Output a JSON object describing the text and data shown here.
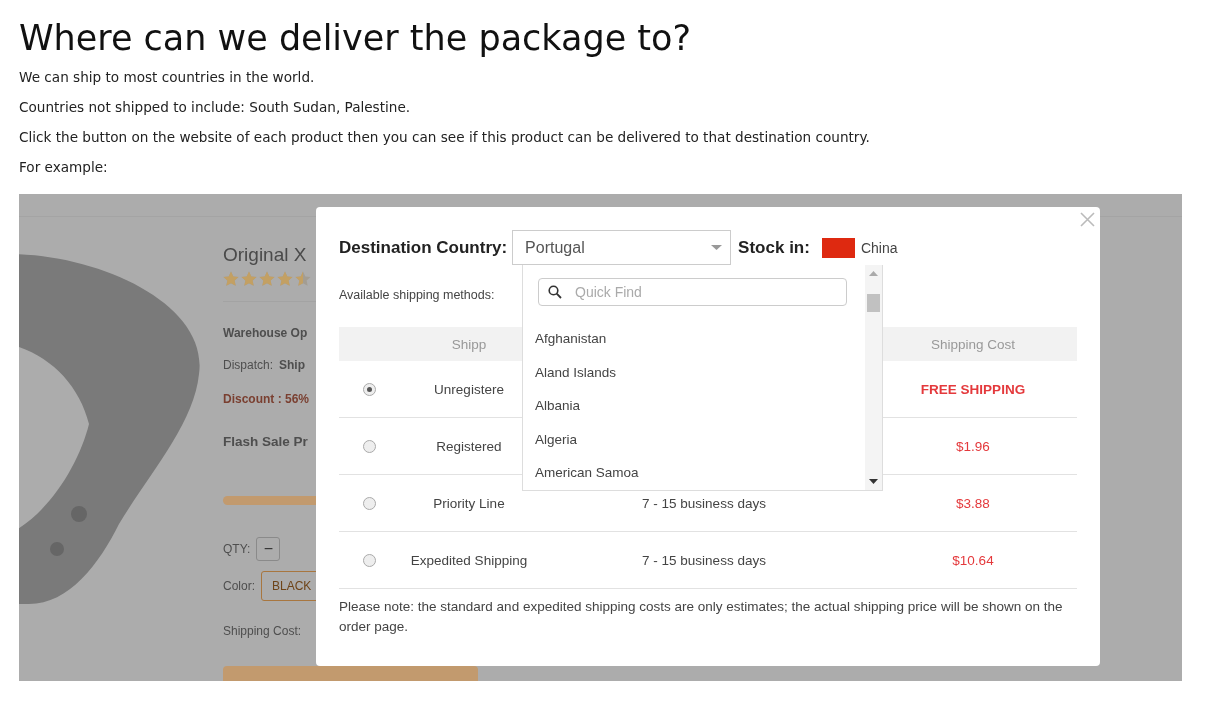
{
  "heading": "Where can we deliver the package to?",
  "paragraphs": [
    "We can ship to most countries in the world.",
    "Countries not shipped to include: South Sudan, Palestine.",
    "Click the button on the website of each product then you can see if this product can be delivered to that destination country.",
    "For example:"
  ],
  "product_page": {
    "title": "Original X",
    "stars": 4.5,
    "warehouse_label": "Warehouse Op",
    "dispatch_label": "Dispatch:",
    "dispatch_value": "Ship",
    "discount": "Discount : 56%",
    "flash_sale": "Flash Sale Pr",
    "qty_label": "QTY:",
    "qty_minus": "−",
    "color_label": "Color:",
    "color_value": "BLACK",
    "shipping_cost_label": "Shipping Cost:"
  },
  "shipping_modal": {
    "destination_label": "Destination Country:",
    "destination_value": "Portugal",
    "stock_label": "Stock in:",
    "stock_country": "China",
    "methods_label": "Available shipping methods:",
    "columns": {
      "method": "Shipp",
      "cost": "Shipping Cost"
    },
    "rows": [
      {
        "selected": true,
        "kind": "free",
        "method": "Unregistere",
        "cost": "FREE SHIPPING"
      },
      {
        "selected": false,
        "kind": "price",
        "method": "Registered",
        "cost": "$1.96"
      },
      {
        "selected": false,
        "kind": "price",
        "method": "Priority Line",
        "time": "7 - 15 business days",
        "cost": "$3.88"
      },
      {
        "selected": false,
        "kind": "price",
        "method": "Expedited Shipping",
        "time": "7 - 15 business days",
        "cost": "$10.64"
      }
    ],
    "note": "Please note: the standard and expedited shipping costs are only estimates; the actual shipping price will be shown on the order page.",
    "dropdown": {
      "search_placeholder": "Quick Find",
      "countries": [
        {
          "name": "Afghanistan",
          "selected": false
        },
        {
          "name": "Aland Islands",
          "selected": false
        },
        {
          "name": "Albania",
          "selected": false
        },
        {
          "name": "Algeria",
          "selected": false
        },
        {
          "name": "American Samoa",
          "selected": false
        }
      ]
    }
  }
}
